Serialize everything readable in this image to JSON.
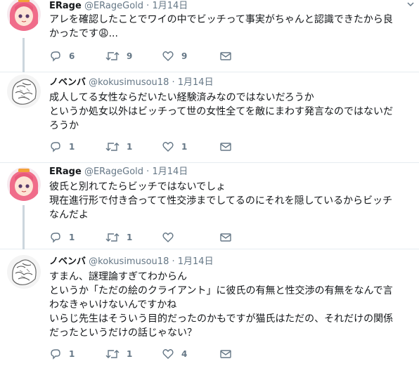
{
  "tweets": [
    {
      "name": "ERage",
      "handle": "@ERageGold",
      "dot": "·",
      "time": "1月14日",
      "lines": [
        "アレを確認したことでワイの中でビッチって事実がちゃんと認識できたから良",
        "かったです😩..."
      ],
      "reply_count": "6",
      "retweet_count": "9",
      "like_count": "9"
    },
    {
      "name": "ノベンバ",
      "handle": "@kokusimusou18",
      "dot": "·",
      "time": "1月14日",
      "lines": [
        "成人してる女性ならだいたい経験済みなのではないだろうか",
        "というか処女以外はビッチって世の女性全てを敵にまわす発言なのではないだ",
        "ろうか"
      ],
      "reply_count": "1",
      "retweet_count": "1",
      "like_count": "1"
    },
    {
      "name": "ERage",
      "handle": "@ERageGold",
      "dot": "·",
      "time": "1月14日",
      "lines": [
        "彼氏と別れてたらビッチではないでしょ",
        "現在進行形で付き合ってて性交渉までしてるのにそれを隠しているからビッチ",
        "なんだよ"
      ],
      "reply_count": "1",
      "retweet_count": "1",
      "like_count": ""
    },
    {
      "name": "ノベンバ",
      "handle": "@kokusimusou18",
      "dot": "·",
      "time": "1月14日",
      "lines": [
        "すまん、謎理論すぎてわからん",
        "というか「ただの絵のクライアント」に彼氏の有無と性交渉の有無をなんで言",
        "わなきゃいけないんですかね",
        "いらじ先生はそういう目的だったのかもですが猫氏はただの、それだけの関係",
        "だったというだけの話じゃない？"
      ],
      "reply_count": "1",
      "retweet_count": "1",
      "like_count": "4"
    }
  ],
  "colors": {
    "text": "#14171a",
    "secondary": "#657786",
    "border": "#e6ecf0",
    "thread": "#ccd6dd"
  },
  "icons": [
    "reply-icon",
    "retweet-icon",
    "like-icon",
    "direct-message-icon",
    "caret-down-icon",
    "avatar-anime",
    "avatar-sketch"
  ]
}
